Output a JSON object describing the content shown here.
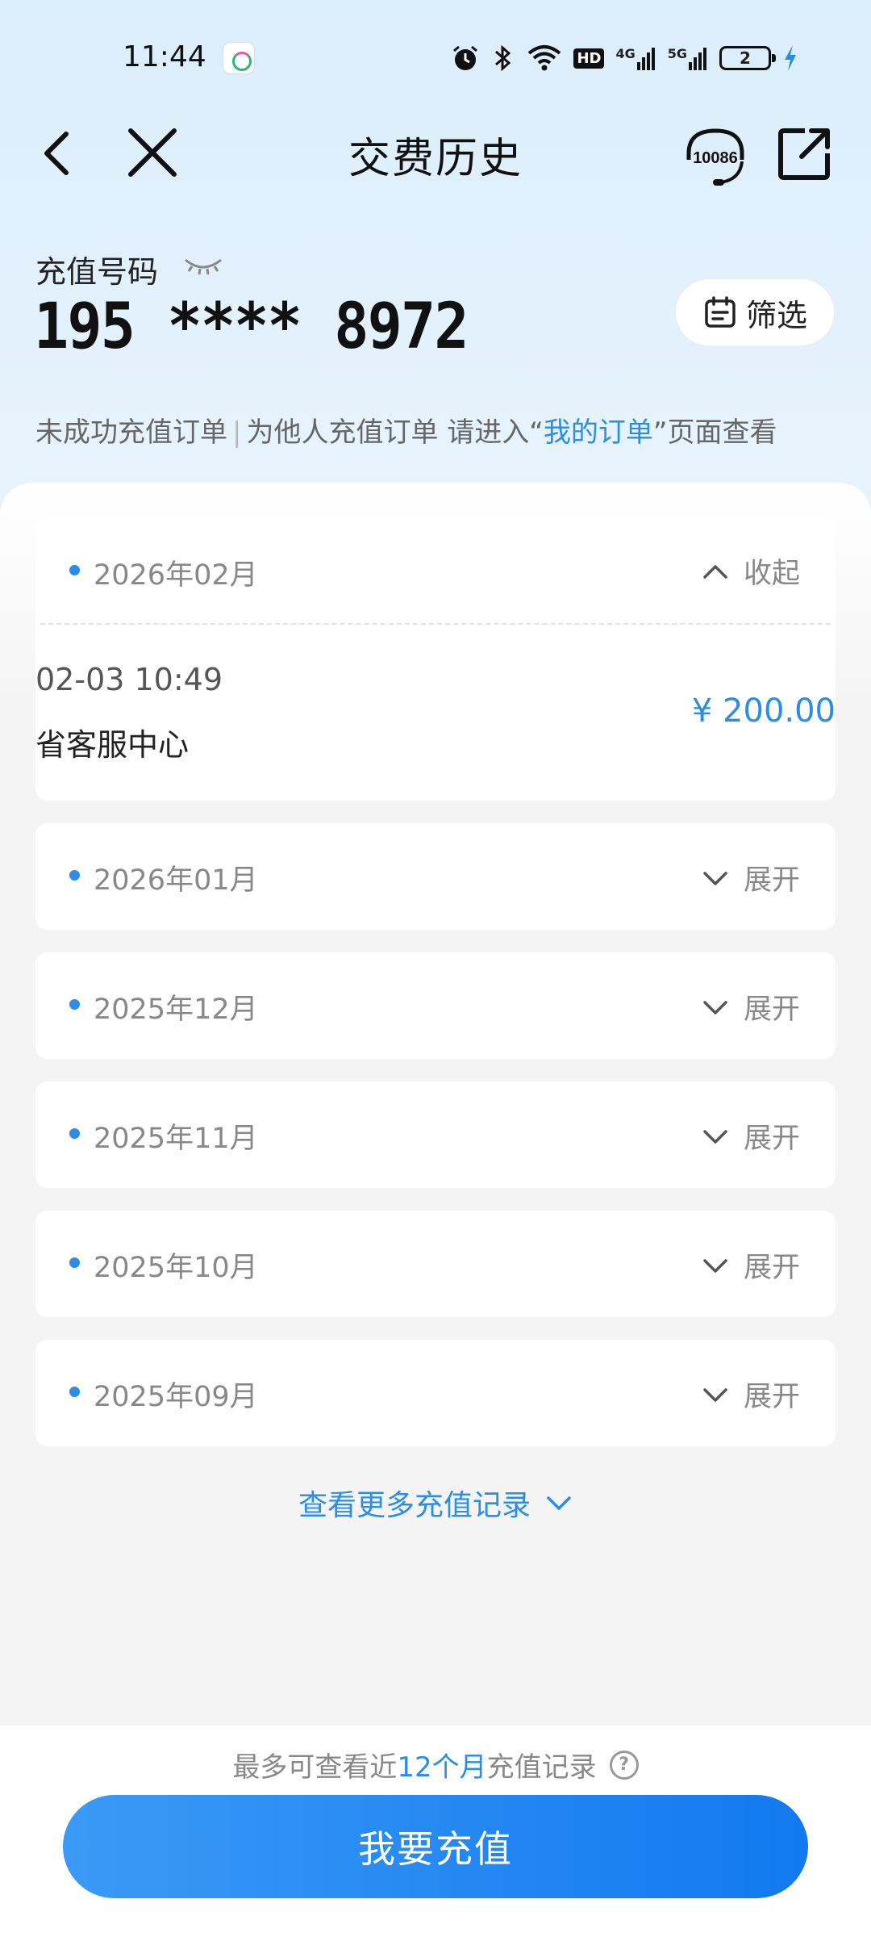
{
  "status_bar": {
    "time": "11:44",
    "network_labels": [
      "HD",
      "4G",
      "5G"
    ],
    "battery": "2"
  },
  "nav": {
    "title": "交费历史",
    "service_number": "10086"
  },
  "account": {
    "label": "充值号码",
    "number": "195 **** 8972",
    "filter_label": "筛选"
  },
  "notice": {
    "part1": "未成功充值订单",
    "part2": "为他人充值订单 请进入“",
    "link": "我的订单",
    "part3": "”页面查看"
  },
  "months": [
    {
      "label": "2026年02月",
      "toggle": "收起",
      "expanded": true,
      "records": [
        {
          "time": "02-03 10:49",
          "place": "省客服中心",
          "amount": "¥ 200.00"
        }
      ]
    },
    {
      "label": "2026年01月",
      "toggle": "展开",
      "expanded": false
    },
    {
      "label": "2025年12月",
      "toggle": "展开",
      "expanded": false
    },
    {
      "label": "2025年11月",
      "toggle": "展开",
      "expanded": false
    },
    {
      "label": "2025年10月",
      "toggle": "展开",
      "expanded": false
    },
    {
      "label": "2025年09月",
      "toggle": "展开",
      "expanded": false
    }
  ],
  "more_label": "查看更多充值记录",
  "limit": {
    "prefix": "最多可查看近",
    "highlight": "12个月",
    "suffix": "充值记录",
    "help_glyph": "?"
  },
  "recharge_button": "我要充值",
  "colors": {
    "accent": "#2b8de6",
    "button_start": "#3a9af5",
    "button_end": "#1279f0",
    "header_bg": "#dbeefb"
  }
}
